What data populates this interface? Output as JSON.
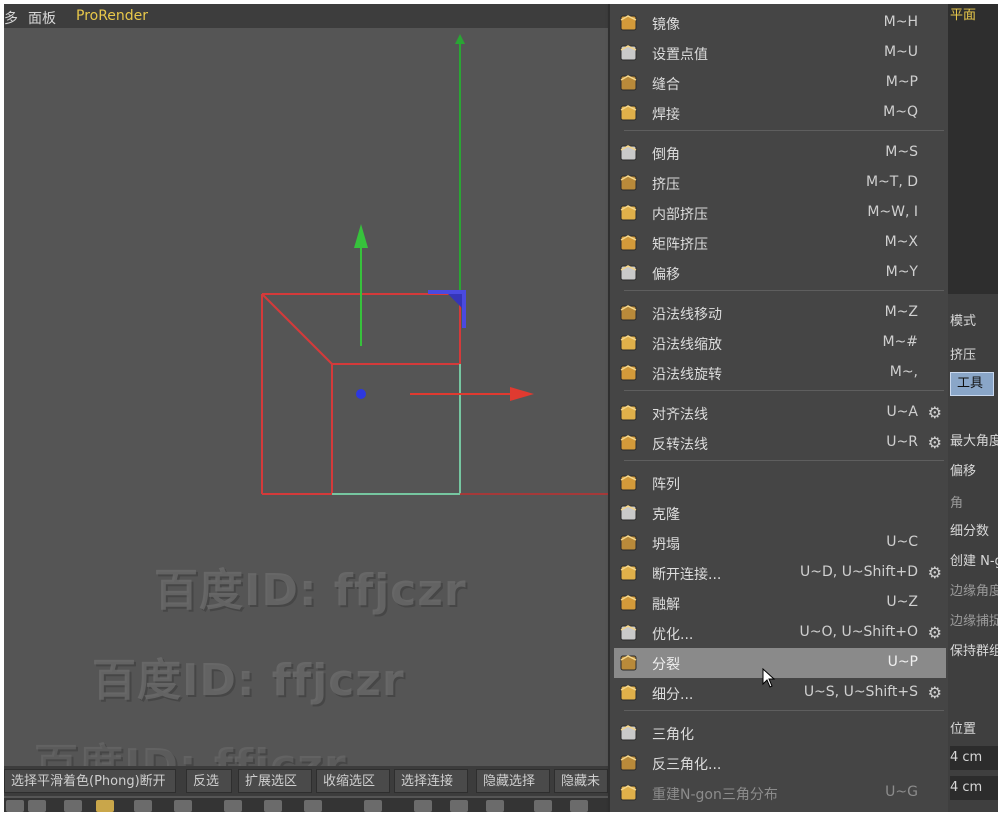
{
  "menubar": {
    "item_cut": "多",
    "panel": "面板",
    "prorender": "ProRender"
  },
  "watermarks": [
    "百度ID: ffjczr",
    "百度ID: ffjczr",
    "百度ID: ffjczr"
  ],
  "bottom_buttons": [
    "选择平滑着色(Phong)断开",
    "反选",
    "扩展选区",
    "收缩选区",
    "选择连接",
    "隐藏选择",
    "隐藏未"
  ],
  "menu": {
    "groups": [
      [
        {
          "icon": "mirror-icon",
          "label": "镜像",
          "shortcut": "M~H"
        },
        {
          "icon": "set-point-value-icon",
          "label": "设置点值",
          "shortcut": "M~U"
        },
        {
          "icon": "stitch-icon",
          "label": "缝合",
          "shortcut": "M~P"
        },
        {
          "icon": "weld-icon",
          "label": "焊接",
          "shortcut": "M~Q"
        }
      ],
      [
        {
          "icon": "bevel-icon",
          "label": "倒角",
          "shortcut": "M~S"
        },
        {
          "icon": "extrude-icon",
          "label": "挤压",
          "shortcut": "M~T, D"
        },
        {
          "icon": "extrude-inner-icon",
          "label": "内部挤压",
          "shortcut": "M~W, I"
        },
        {
          "icon": "matrix-extrude-icon",
          "label": "矩阵挤压",
          "shortcut": "M~X"
        },
        {
          "icon": "offset-icon",
          "label": "偏移",
          "shortcut": "M~Y"
        }
      ],
      [
        {
          "icon": "normal-move-icon",
          "label": "沿法线移动",
          "shortcut": "M~Z"
        },
        {
          "icon": "normal-scale-icon",
          "label": "沿法线缩放",
          "shortcut": "M~#"
        },
        {
          "icon": "normal-rotate-icon",
          "label": "沿法线旋转",
          "shortcut": "M~,"
        }
      ],
      [
        {
          "icon": "align-normals-icon",
          "label": "对齐法线",
          "shortcut": "U~A",
          "gear": true
        },
        {
          "icon": "reverse-normals-icon",
          "label": "反转法线",
          "shortcut": "U~R",
          "gear": true
        }
      ],
      [
        {
          "icon": "array-icon",
          "label": "阵列",
          "shortcut": ""
        },
        {
          "icon": "clone-icon",
          "label": "克隆",
          "shortcut": ""
        },
        {
          "icon": "collapse-icon",
          "label": "坍塌",
          "shortcut": "U~C"
        },
        {
          "icon": "disconnect-icon",
          "label": "断开连接...",
          "shortcut": "U~D, U~Shift+D",
          "gear": true
        },
        {
          "icon": "melt-icon",
          "label": "融解",
          "shortcut": "U~Z"
        },
        {
          "icon": "optimize-icon",
          "label": "优化...",
          "shortcut": "U~O, U~Shift+O",
          "gear": true
        },
        {
          "icon": "split-icon",
          "label": "分裂",
          "shortcut": "U~P",
          "highlight": true
        },
        {
          "icon": "subdivide-icon",
          "label": "细分...",
          "shortcut": "U~S, U~Shift+S",
          "gear": true
        }
      ],
      [
        {
          "icon": "triangulate-icon",
          "label": "三角化",
          "shortcut": ""
        },
        {
          "icon": "untriangulate-icon",
          "label": "反三角化...",
          "shortcut": ""
        },
        {
          "icon": "retriangulate-ngons-icon",
          "label": "重建N-gon三角分布",
          "shortcut": "U~G",
          "disabled": true
        }
      ]
    ]
  },
  "right_panel": {
    "top_label": "平面",
    "mode": "模式",
    "extrude": "挤压",
    "tool": "工具",
    "max_angle": "最大角度",
    "offset": "偏移",
    "angle": "角",
    "subdivisions": "细分数",
    "create_ngon": "创建 N-g",
    "edge_angle": "边缘角度",
    "edge_snap": "边缘捕捉",
    "keep_groups": "保持群组",
    "position": "位置",
    "value1": "4 cm",
    "value2": "4 cm"
  },
  "colors": {
    "highlight": "#8a8a8a",
    "accent_label": "#e8c84a",
    "axis_x": "#e0392f",
    "axis_y": "#35c23c",
    "axis_z": "#2d38e0"
  }
}
